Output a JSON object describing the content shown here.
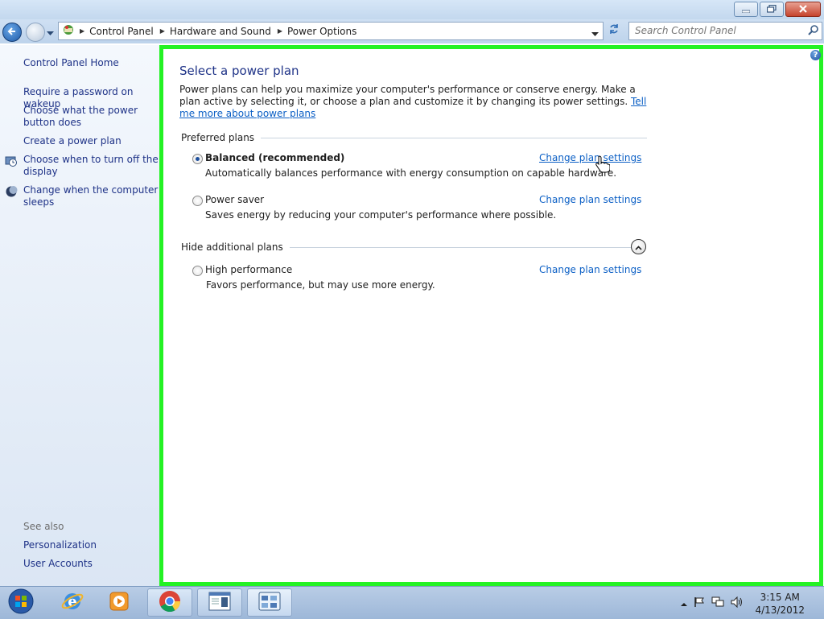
{
  "window": {
    "minimize_icon": "minimize-icon",
    "maximize_icon": "restore-icon",
    "close_icon": "close-icon"
  },
  "address_bar": {
    "breadcrumbs": [
      "Control Panel",
      "Hardware and Sound",
      "Power Options"
    ],
    "search_placeholder": "Search Control Panel"
  },
  "sidebar": {
    "home": "Control Panel Home",
    "tasks": [
      {
        "label": "Require a password on wakeup",
        "icon": null
      },
      {
        "label": "Choose what the power button does",
        "icon": null
      },
      {
        "label": "Create a power plan",
        "icon": null
      },
      {
        "label": "Choose when to turn off the display",
        "icon": "display-clock-icon"
      },
      {
        "label": "Change when the computer sleeps",
        "icon": "moon-icon"
      }
    ],
    "see_also_label": "See also",
    "see_also": [
      "Personalization",
      "User Accounts"
    ]
  },
  "main": {
    "title": "Select a power plan",
    "description": "Power plans can help you maximize your computer's performance or conserve energy. Make a plan active by selecting it, or choose a plan and customize it by changing its power settings. ",
    "description_link": "Tell me more about power plans",
    "preferred_label": "Preferred plans",
    "additional_label": "Hide additional plans",
    "plans": [
      {
        "name": "Balanced (recommended)",
        "description": "Automatically balances performance with energy consumption on capable hardware.",
        "selected": true,
        "link": "Change plan settings"
      },
      {
        "name": "Power saver",
        "description": "Saves energy by reducing your computer's performance where possible.",
        "selected": false,
        "link": "Change plan settings"
      },
      {
        "name": "High performance",
        "description": "Favors performance, but may use more energy.",
        "selected": false,
        "link": "Change plan settings"
      }
    ]
  },
  "taskbar": {
    "time": "3:15 AM",
    "date": "4/13/2012",
    "apps": [
      "start-orb-icon",
      "internet-explorer-icon",
      "media-player-icon",
      "chrome-icon",
      "notepad-window-icon",
      "control-panel-icon"
    ]
  },
  "colors": {
    "highlight_border": "#24f224",
    "link": "#0b5fc5",
    "title": "#1e3287"
  }
}
